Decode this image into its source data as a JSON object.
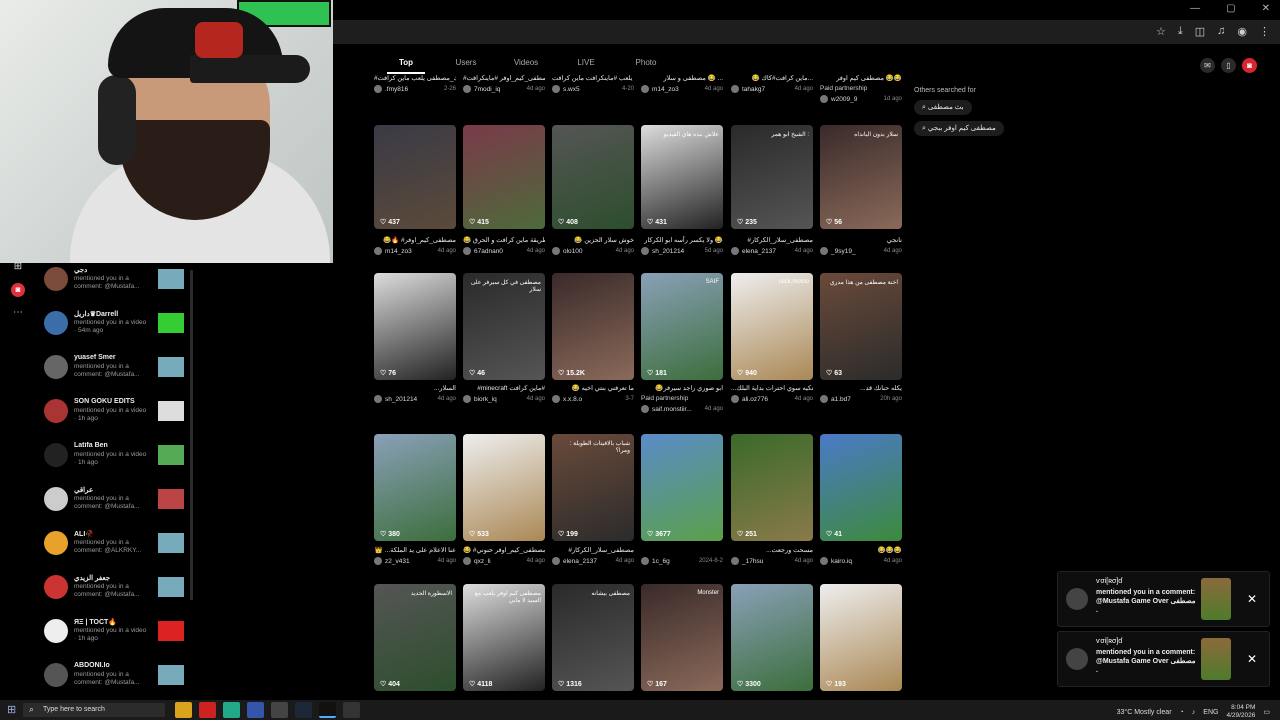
{
  "tabs": [
    "Top",
    "Users",
    "Videos",
    "LIVE",
    "Photo"
  ],
  "row1": [
    {
      "caption": "#ستاك_مصطفى يلعب ماين كرافت",
      "user": ".fmy816",
      "date": "2-26"
    },
    {
      "caption": "#مصطفى_كيم_اوفر #ماينكرافت",
      "user": "7modi_iq",
      "date": "4d ago"
    },
    {
      "caption": "مصطفى يلعب #ماينكرافت ماين كرافت",
      "user": "s.wx5",
      "date": "4-20"
    },
    {
      "caption": "مصطفى و سلار 😂 ...",
      "user": "m14_zo3",
      "date": "4d ago"
    },
    {
      "caption": "😂 ماين كرافت#كاك...",
      "user": "tahakg7",
      "date": "4d ago"
    },
    {
      "caption": "مصطفى كيم اوفر 😂😂",
      "user": "w2009_9",
      "date": "1d ago",
      "paid": "Paid partnership"
    }
  ],
  "row2": [
    {
      "likes": "437",
      "caption": "😂🔥 #مصطفى_كيم_اوفر",
      "user": "m14_zo3",
      "date": "4d ago",
      "overlay": ""
    },
    {
      "likes": "415",
      "caption": "😂 طريقة ماين كرافت و الحرق",
      "user": "67adnan0",
      "date": "4d ago",
      "overlay": ""
    },
    {
      "likes": "408",
      "caption": "😂 خوش سلار الحزين",
      "user": "olo100",
      "date": "4d ago",
      "overlay": ""
    },
    {
      "likes": "431",
      "caption": "ولا يكسر رأسه ابو الكركار 😂",
      "user": "sh_201214",
      "date": "5d ago",
      "overlay": "علاش بنده هاي الفيديو"
    },
    {
      "likes": "235",
      "caption": "#مصطفى_سلار_الكركار",
      "user": "elena_2137",
      "date": "4d ago",
      "overlay": "الشيخ ابو همر :"
    },
    {
      "likes": "56",
      "caption": "نانجي",
      "user": "_9sy19_",
      "date": "4d ago",
      "overlay": "سلار بدون اليانداه"
    }
  ],
  "row3": [
    {
      "likes": "76",
      "caption": "...السلار",
      "user": "sh_201214",
      "date": "4d ago",
      "overlay": ""
    },
    {
      "likes": "46",
      "caption": "#minecraft ماين كرافت#",
      "user": "biork_iq",
      "date": "4d ago",
      "overlay": "مصطفى في كل سيرفر على سلار"
    },
    {
      "likes": "15.2K",
      "caption": "😂 ما تعرفني بنتي اخيه",
      "user": "x.x.8.o",
      "date": "3-7",
      "overlay": ""
    },
    {
      "likes": "181",
      "caption": "😂ابو صوري راجد سيرفر",
      "user": "saif.monstiir...",
      "date": "4d ago",
      "overlay": "SAIF",
      "paid": "Paid partnership"
    },
    {
      "likes": "940",
      "caption": "...دانكيه سوي احترات بداية البلك",
      "user": "ali.oz776",
      "date": "4d ago",
      "overlay": "ciick.motoo"
    },
    {
      "likes": "63",
      "caption": "...يكله حنانك قد",
      "user": "a1.bd7",
      "date": "20h ago",
      "overlay": "اخنة مصطفى من هذا مدري"
    }
  ],
  "row4": [
    {
      "likes": "380",
      "caption": "👑 ...عنا الاعلام على يد الملكة",
      "user": "z2_v431",
      "date": "4d ago",
      "overlay": ""
    },
    {
      "likes": "533",
      "caption": "😂 #مصطفى_كيم_اوفر حنوني",
      "user": "qxz_li",
      "date": "4d ago",
      "overlay": ""
    },
    {
      "likes": "199",
      "caption": "#مصطفى_سلار_الكركار",
      "user": "elena_2137",
      "date": "4d ago",
      "overlay": "شباب بالافيتات الطويلة : ومرا؟"
    },
    {
      "likes": "3677",
      "caption": "",
      "user": "1c_6g",
      "date": "2024-8-2",
      "overlay": ""
    },
    {
      "likes": "251",
      "caption": "...مسحت ورجعت",
      "user": "_17hsu",
      "date": "4d ago",
      "overlay": ""
    },
    {
      "likes": "41",
      "caption": "😂😂😂",
      "user": "kairo.iq",
      "date": "4d ago",
      "overlay": ""
    }
  ],
  "row5": [
    {
      "likes": "404",
      "overlay": "الاسطورة الحديد"
    },
    {
      "likes": "4118",
      "overlay": "مصطفى كيم اوفر يلعب مع السيد لا مابي"
    },
    {
      "likes": "1316",
      "overlay": "مصطفى بيشانه"
    },
    {
      "likes": "167",
      "overlay": "Monster"
    },
    {
      "likes": "3300",
      "overlay": ""
    },
    {
      "likes": "193",
      "overlay": ""
    }
  ],
  "others": {
    "heading": "Others searched for",
    "chips": [
      "بث مصطفى",
      "مصطفى كيم اوفر ببجي"
    ]
  },
  "notifications": [
    {
      "name": "دجي",
      "text": "mentioned you in a comment: @Mustafa...",
      "color": "#7a4b3a",
      "thumb": "#7ab"
    },
    {
      "name": "داريل♛Darrell",
      "text": "mentioned you in a video · 54m ago",
      "color": "#3b6ea8",
      "thumb": "#3c3"
    },
    {
      "name": "yuasef Smer",
      "text": "mentioned you in a comment: @Mustafa...",
      "color": "#666",
      "thumb": "#7ab"
    },
    {
      "name": "SON GOKU EDITS",
      "text": "mentioned you in a video · 1h ago",
      "color": "#a33",
      "thumb": "#ddd"
    },
    {
      "name": "Latifa Ben",
      "text": "mentioned you in a video · 1h ago",
      "color": "#222",
      "thumb": "#5a5"
    },
    {
      "name": "عراقي",
      "text": "mentioned you in a comment: @Mustafa...",
      "color": "#ccc",
      "thumb": "#b44"
    },
    {
      "name": "ALI🥀",
      "text": "mentioned you in a comment: @ALKRKY...",
      "color": "#e8a12a",
      "thumb": "#7ab"
    },
    {
      "name": "جعفر الزيدي",
      "text": "mentioned you in a comment: @Mustafa...",
      "color": "#c33",
      "thumb": "#7ab"
    },
    {
      "name": "ЯΞ | TOCT🔥",
      "text": "mentioned you in a video · 1h ago",
      "color": "#eee",
      "thumb": "#d22"
    },
    {
      "name": "ABDONI.lo",
      "text": "mentioned you in a comment: @Mustafa...",
      "color": "#555",
      "thumb": "#7ab"
    }
  ],
  "toasts": [
    {
      "user": "ѵσі[ʀσ]ɗ",
      "msg": "mentioned you in a comment: @Mustafa Game Over مصطفى ."
    },
    {
      "user": "ѵσі[ʀσ]ɗ",
      "msg": "mentioned you in a comment: @Mustafa Game Over مصطفى ."
    }
  ],
  "taskbar": {
    "search_placeholder": "Type here to search",
    "weather": "33°C  Mostly clear",
    "lang": "ENG",
    "time": "8:04 PM",
    "date": "4/29/2026"
  },
  "browser": {
    "close": "✕",
    "minimize": "—",
    "maximize": "▢"
  }
}
